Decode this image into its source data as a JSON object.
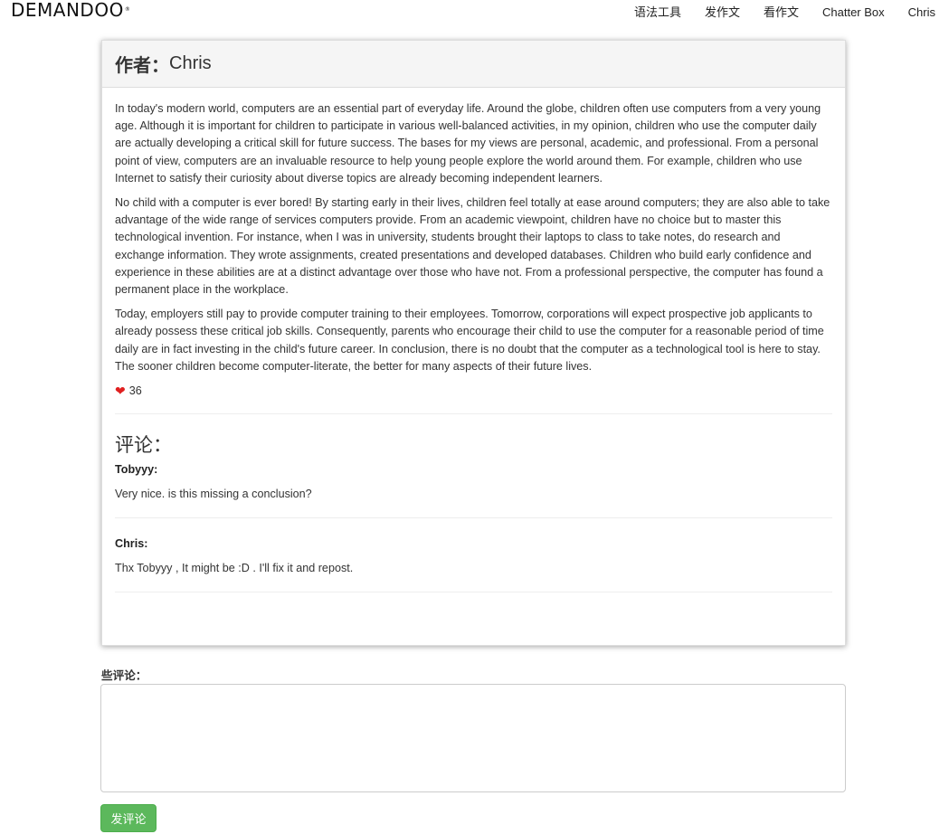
{
  "brand": {
    "name": "DEMANDOO",
    "mark": "®"
  },
  "nav": {
    "items": [
      "语法工具",
      "发作文",
      "看作文",
      "Chatter Box",
      "Chris"
    ]
  },
  "post": {
    "author_prefix": "作者：",
    "author": "Chris",
    "paragraphs": [
      "In today's modern world, computers are an essential part of everyday life. Around the globe, children often use computers from a very young age. Although it is important for children to participate in various well-balanced activities, in my opinion, children who use the computer daily are actually developing a critical skill for future success. The bases for my views are personal, academic, and professional. From a personal point of view, computers are an invaluable resource to help young people explore the world around them. For example, children who use Internet to satisfy their curiosity about diverse topics are already becoming independent learners.",
      "No child with a computer is ever bored! By starting early in their lives, children feel totally at ease around computers; they are also able to take advantage of the wide range of services computers provide. From an academic viewpoint, children have no choice but to master this technological invention. For instance, when I was in university, students brought their laptops to class to take notes, do research and exchange information. They wrote assignments, created presentations and developed databases. Children who build early confidence and experience in these abilities are at a distinct advantage over those who have not. From a professional perspective, the computer has found a permanent place in the workplace.",
      "Today, employers still pay to provide computer training to their employees. Tomorrow, corporations will expect prospective job applicants to already possess these critical job skills. Consequently, parents who encourage their child to use the computer for a reasonable period of time daily are in fact investing in the child's future career. In conclusion, there is no doubt that the computer as a technological tool is here to stay. The sooner children become computer-literate, the better for many aspects of their future lives."
    ],
    "likes": "36",
    "heart_icon": "heart-icon",
    "heart_color": "#e02020"
  },
  "comments": {
    "title": "评论：",
    "items": [
      {
        "author": "Tobyyy:",
        "text": "Very nice. is this missing a conclusion?"
      },
      {
        "author": "Chris:",
        "text": "Thx Tobyyy , It might be :D . I'll fix it and repost."
      }
    ]
  },
  "form": {
    "label": "些评论：",
    "textarea_value": "",
    "submit_label": "发评论",
    "submit_color": "#5cb85c"
  }
}
